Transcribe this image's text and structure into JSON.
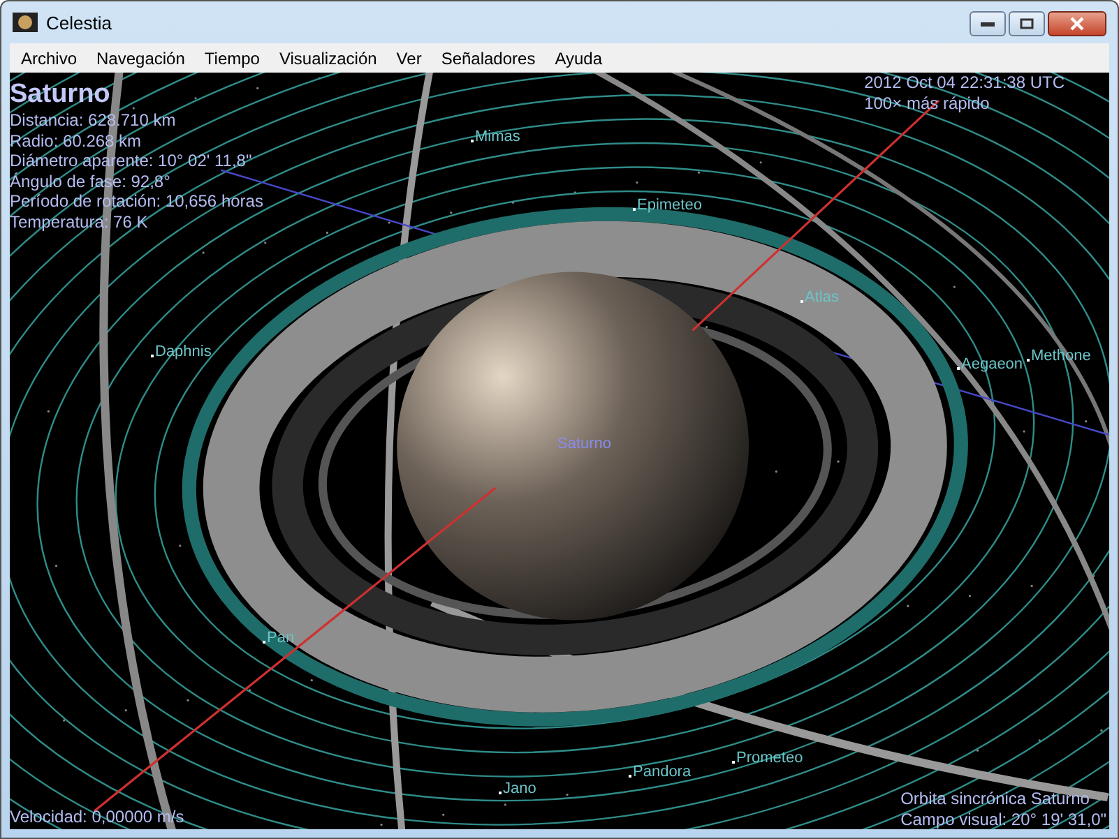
{
  "window": {
    "title": "Celestia"
  },
  "menu": [
    "Archivo",
    "Navegación",
    "Tiempo",
    "Visualización",
    "Ver",
    "Señaladores",
    "Ayuda"
  ],
  "info": {
    "object_name": "Saturno",
    "lines": [
      "Distancia: 628.710 km",
      "Radio: 60.268 km",
      "Diámetro aparente: 10° 02' 11,8\"",
      "Ángulo de fase: 92,8°",
      "Período de rotación: 10,656 horas",
      "Temperatura: 76 K"
    ]
  },
  "time": {
    "date": "2012 Oct 04 22:31:38 UTC",
    "rate": "100× más rápido"
  },
  "velocity": "Velocidad: 0,00000 m/s",
  "status": [
    "Orbita sincrónica Saturno",
    "Campo visual: 20° 19' 31,0\""
  ],
  "labels": [
    {
      "name": "Mimas",
      "kind": "moon"
    },
    {
      "name": "Epimeteo",
      "kind": "moon"
    },
    {
      "name": "Atlas",
      "kind": "moon"
    },
    {
      "name": "Daphnis",
      "kind": "moon"
    },
    {
      "name": "Aegaeon",
      "kind": "moon"
    },
    {
      "name": "Methone",
      "kind": "moon"
    },
    {
      "name": "Saturno",
      "kind": "planet"
    },
    {
      "name": "Pan",
      "kind": "moon"
    },
    {
      "name": "Prometeo",
      "kind": "moon"
    },
    {
      "name": "Pandora",
      "kind": "moon"
    },
    {
      "name": "Jano",
      "kind": "moon"
    }
  ]
}
